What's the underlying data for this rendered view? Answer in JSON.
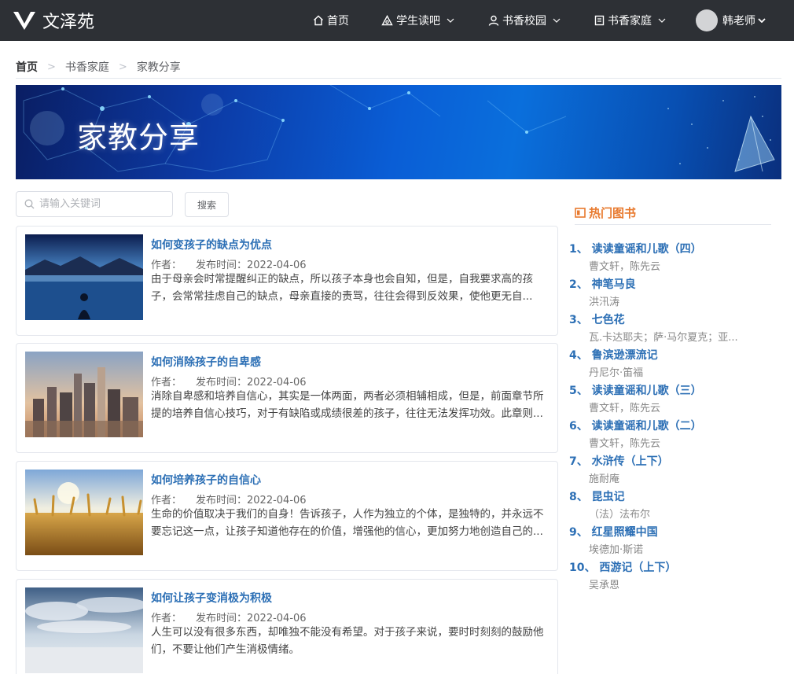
{
  "app": {
    "logo_text": "文泽苑"
  },
  "nav": {
    "home": "首页",
    "items": [
      {
        "label": "学生读吧"
      },
      {
        "label": "书香校园"
      },
      {
        "label": "书香家庭"
      }
    ],
    "user": "韩老师"
  },
  "breadcrumb": [
    "首页",
    "书香家庭",
    "家教分享"
  ],
  "banner": {
    "title": "家教分享"
  },
  "search": {
    "placeholder": "请输入关键词",
    "button": "搜索"
  },
  "articles": [
    {
      "title": "如何变孩子的缺点为优点",
      "author_label": "作者：",
      "date_label": "发布时间：2022-04-06",
      "summary": "由于母亲会时常提醒纠正的缺点，所以孩子本身也会自知，但是，自我要求高的孩子，会常常挂虑自己的缺点，母亲直接的责骂，往往会得到反效果，使他更无自..."
    },
    {
      "title": "如何消除孩子的自卑感",
      "author_label": "作者：",
      "date_label": "发布时间：2022-04-06",
      "summary": "消除自卑感和培养自信心，其实是一体两面，两者必须相辅相成，但是，前面章节所提的培养自信心技巧，对于有缺陷或成绩很差的孩子，往往无法发挥功效。此章则..."
    },
    {
      "title": "如何培养孩子的自信心",
      "author_label": "作者：",
      "date_label": "发布时间：2022-04-06",
      "summary": "生命的价值取决于我们的自身！告诉孩子，人作为独立的个体，是独特的，并永远不要忘记这一点，让孩子知道他存在的价值，增强他的信心，更加努力地创造自己的..."
    },
    {
      "title": "如何让孩子变消极为积极",
      "author_label": "作者：",
      "date_label": "发布时间：2022-04-06",
      "summary": "人生可以没有很多东西，却唯独不能没有希望。对于孩子来说，要时时刻刻的鼓励他们，不要让他们产生消极情绪。"
    }
  ],
  "hot_books": {
    "heading": "热门图书",
    "items": [
      {
        "title": "1、 读读童谣和儿歌（四）",
        "author": "曹文轩，陈先云"
      },
      {
        "title": "2、 神笔马良",
        "author": "洪汛涛"
      },
      {
        "title": "3、 七色花",
        "author": "瓦.卡达耶夫；萨·马尔夏克；亚..."
      },
      {
        "title": "4、 鲁滨逊漂流记",
        "author": "丹尼尔·笛福"
      },
      {
        "title": "5、 读读童谣和儿歌（三）",
        "author": "曹文轩，陈先云"
      },
      {
        "title": "6、 读读童谣和儿歌（二）",
        "author": "曹文轩，陈先云"
      },
      {
        "title": "7、 水浒传（上下）",
        "author": "施耐庵"
      },
      {
        "title": "8、 昆虫记",
        "author": "（法）法布尔"
      },
      {
        "title": "9、 红星照耀中国",
        "author": "埃德加·斯诺"
      },
      {
        "title": "10、 西游记（上下）",
        "author": "吴承恩"
      }
    ]
  },
  "colors": {
    "topbar": "#2d3035",
    "link": "#2c6fb5",
    "accent": "#e87a2f"
  }
}
